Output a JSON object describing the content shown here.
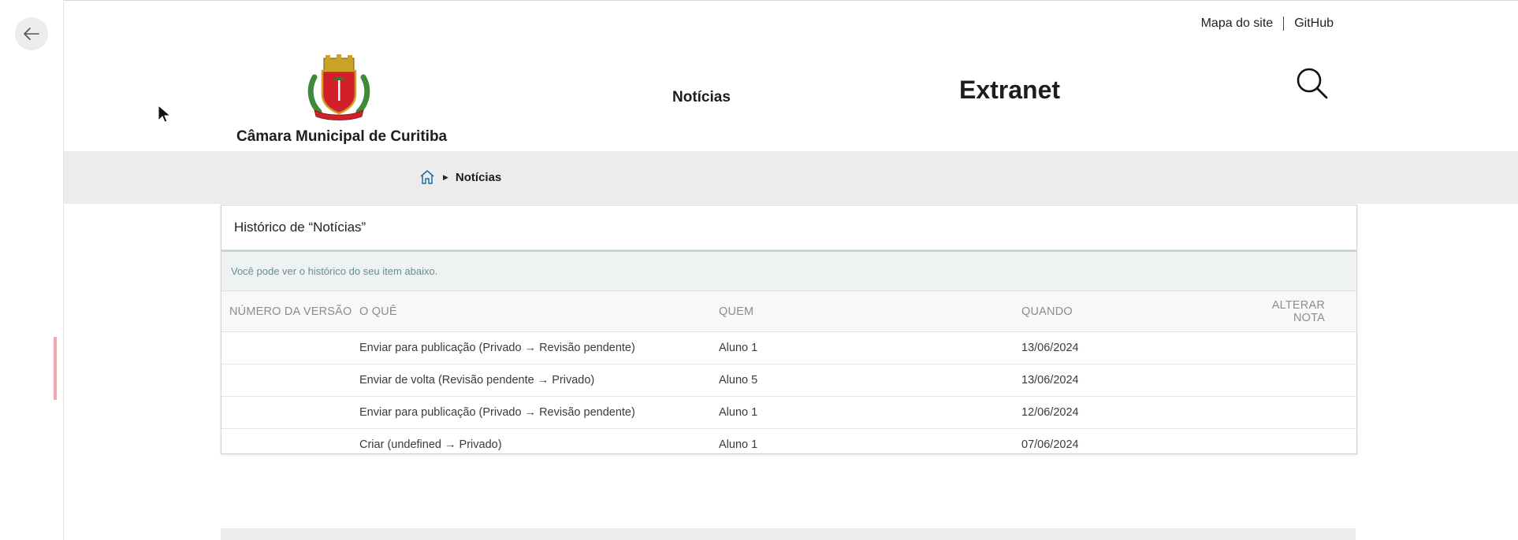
{
  "header": {
    "top_links": [
      "Mapa do site",
      "GitHub"
    ],
    "org_name": "Câmara Municipal de Curitiba",
    "nav": [
      "Notícias",
      "Extranet"
    ]
  },
  "breadcrumb": {
    "current": "Notícias"
  },
  "history": {
    "title": "Histórico de “Notícias”",
    "description": "Você pode ver o histórico do seu item abaixo.",
    "columns": [
      "NÚMERO DA VERSÃO",
      "O QUÊ",
      "QUEM",
      "QUANDO",
      "ALTERAR NOTA"
    ],
    "rows": [
      {
        "version": "",
        "what": "Enviar para publicação (Privado → Revisão pendente)",
        "who": "Aluno 1",
        "when": "13/06/2024",
        "note": ""
      },
      {
        "version": "",
        "what": "Enviar de volta (Revisão pendente → Privado)",
        "who": "Aluno 5",
        "when": "13/06/2024",
        "note": ""
      },
      {
        "version": "",
        "what": "Enviar para publicação (Privado → Revisão pendente)",
        "who": "Aluno 1",
        "when": "12/06/2024",
        "note": ""
      },
      {
        "version": "",
        "what": "Criar (undefined → Privado)",
        "who": "Aluno 1",
        "when": "07/06/2024",
        "note": ""
      }
    ]
  },
  "icons": {
    "back": "arrow-left-icon",
    "search": "search-icon",
    "home": "home-icon",
    "crest": "coat-of-arms-icon"
  },
  "colors": {
    "breadcrumb_bg": "#ececec",
    "table_desc_text": "#6b8e8a",
    "title_underline": "#c6d6d4",
    "home_icon": "#1a6e9e"
  }
}
